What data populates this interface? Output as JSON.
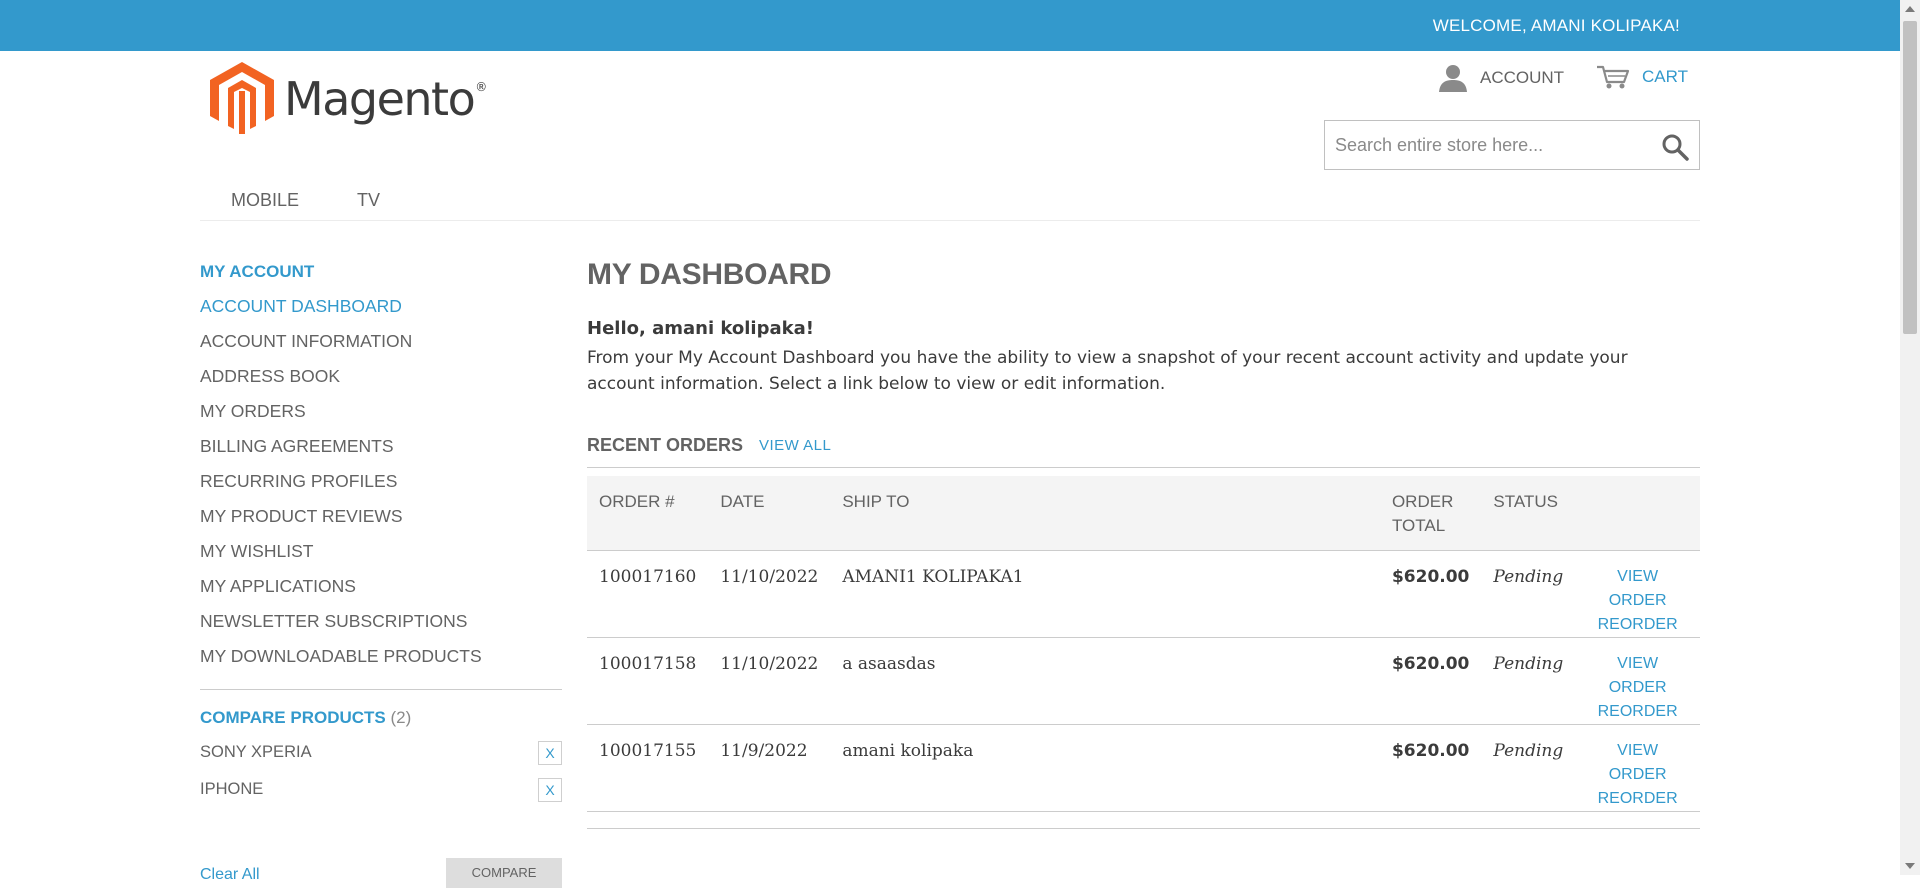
{
  "topbar": {
    "welcome": "WELCOME, AMANI KOLIPAKA!"
  },
  "logo": {
    "text": "Magento",
    "reg": "®"
  },
  "header": {
    "account_label": "ACCOUNT",
    "cart_label": "CART",
    "search_placeholder": "Search entire store here..."
  },
  "nav": {
    "items": [
      {
        "label": "MOBILE"
      },
      {
        "label": "TV"
      }
    ]
  },
  "sidebar": {
    "title": "MY ACCOUNT",
    "items": [
      {
        "label": "ACCOUNT DASHBOARD",
        "active": true
      },
      {
        "label": "ACCOUNT INFORMATION"
      },
      {
        "label": "ADDRESS BOOK"
      },
      {
        "label": "MY ORDERS"
      },
      {
        "label": "BILLING AGREEMENTS"
      },
      {
        "label": "RECURRING PROFILES"
      },
      {
        "label": "MY PRODUCT REVIEWS"
      },
      {
        "label": "MY WISHLIST"
      },
      {
        "label": "MY APPLICATIONS"
      },
      {
        "label": "NEWSLETTER SUBSCRIPTIONS"
      },
      {
        "label": "MY DOWNLOADABLE PRODUCTS"
      }
    ]
  },
  "compare": {
    "title": "COMPARE PRODUCTS",
    "count": "(2)",
    "items": [
      {
        "label": "SONY XPERIA"
      },
      {
        "label": "IPHONE"
      }
    ],
    "remove_label": "X",
    "clear_all": "Clear All",
    "compare_button": "COMPARE"
  },
  "main": {
    "title": "MY DASHBOARD",
    "hello": "Hello, amani kolipaka!",
    "intro": "From your My Account Dashboard you have the ability to view a snapshot of your recent account activity and update your account information. Select a link below to view or edit information.",
    "recent_orders_title": "RECENT ORDERS",
    "view_all": "VIEW ALL",
    "columns": {
      "order": "ORDER #",
      "date": "DATE",
      "ship_to": "SHIP TO",
      "order_total_1": "ORDER",
      "order_total_2": "TOTAL",
      "status": "STATUS"
    },
    "orders": [
      {
        "number": "100017160",
        "date": "11/10/2022",
        "ship_to": "AMANI1 KOLIPAKA1",
        "total": "$620.00",
        "status": "Pending",
        "view": "VIEW ORDER",
        "reorder": "REORDER"
      },
      {
        "number": "100017158",
        "date": "11/10/2022",
        "ship_to": "a asaasdas",
        "total": "$620.00",
        "status": "Pending",
        "view": "VIEW ORDER",
        "reorder": "REORDER"
      },
      {
        "number": "100017155",
        "date": "11/9/2022",
        "ship_to": "amani kolipaka",
        "total": "$620.00",
        "status": "Pending",
        "view": "VIEW ORDER",
        "reorder": "REORDER"
      }
    ]
  },
  "colors": {
    "accent": "#3399cc",
    "logo_orange": "#f26322",
    "text": "#636363"
  }
}
